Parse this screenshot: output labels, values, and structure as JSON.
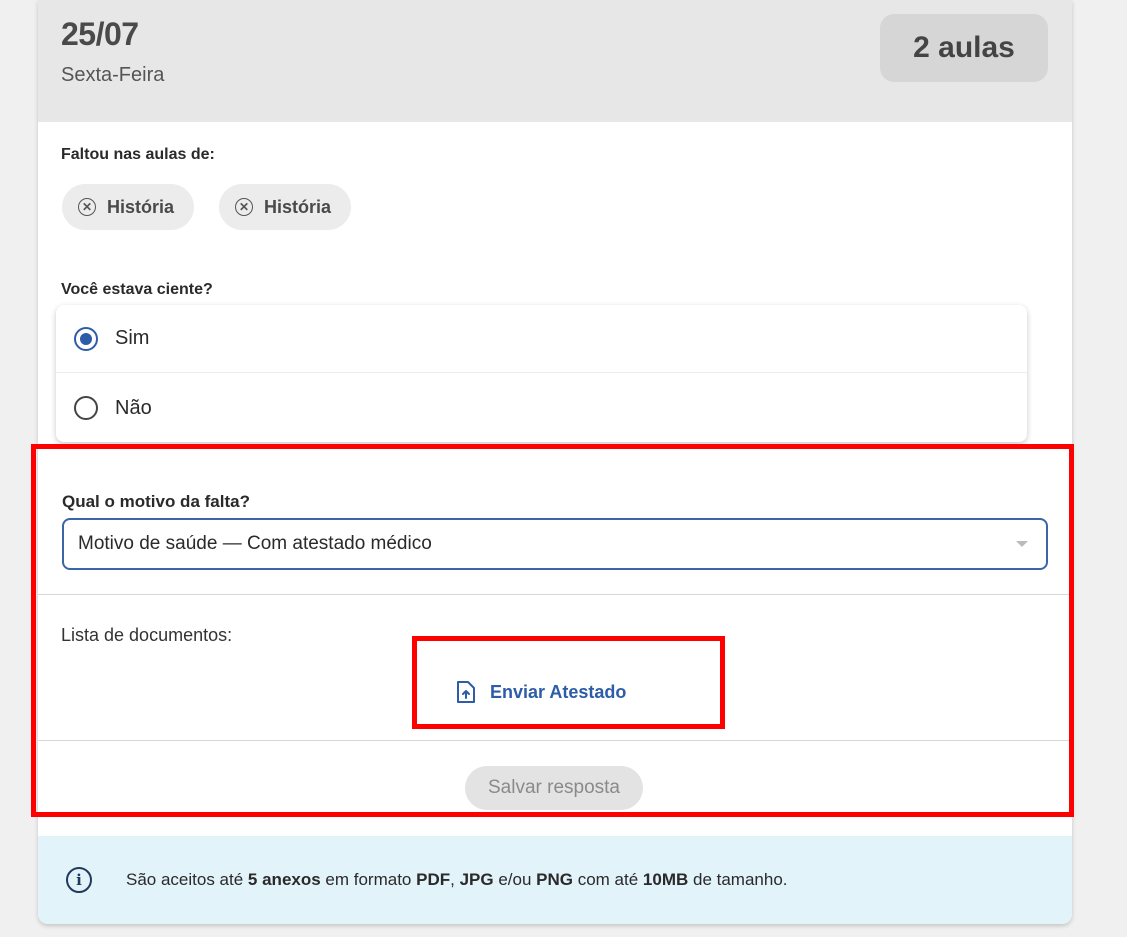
{
  "header": {
    "date": "25/07",
    "weekday": "Sexta-Feira",
    "lessons_badge": "2 aulas"
  },
  "missed": {
    "label": "Faltou nas aulas de:",
    "chips": [
      "História",
      "História"
    ]
  },
  "awareness": {
    "question": "Você estava ciente?",
    "options": [
      "Sim",
      "Não"
    ],
    "selected": "Sim"
  },
  "reason": {
    "label": "Qual o motivo da falta?",
    "selected_value": "Motivo de saúde — Com atestado médico"
  },
  "documents": {
    "label": "Lista de documentos:",
    "upload_label": "Enviar Atestado"
  },
  "save_label": "Salvar resposta",
  "info": {
    "t1": "São aceitos até ",
    "b1": "5 anexos",
    "t2": " em formato ",
    "b2": "PDF",
    "t3": ", ",
    "b3": "JPG",
    "t4": " e/ou ",
    "b4": "PNG",
    "t5": " com até ",
    "b5": "10MB",
    "t6": " de tamanho."
  },
  "colors": {
    "accent": "#2d5ca8",
    "highlight": "#ff0000",
    "info_bg": "#e2f3fa"
  }
}
